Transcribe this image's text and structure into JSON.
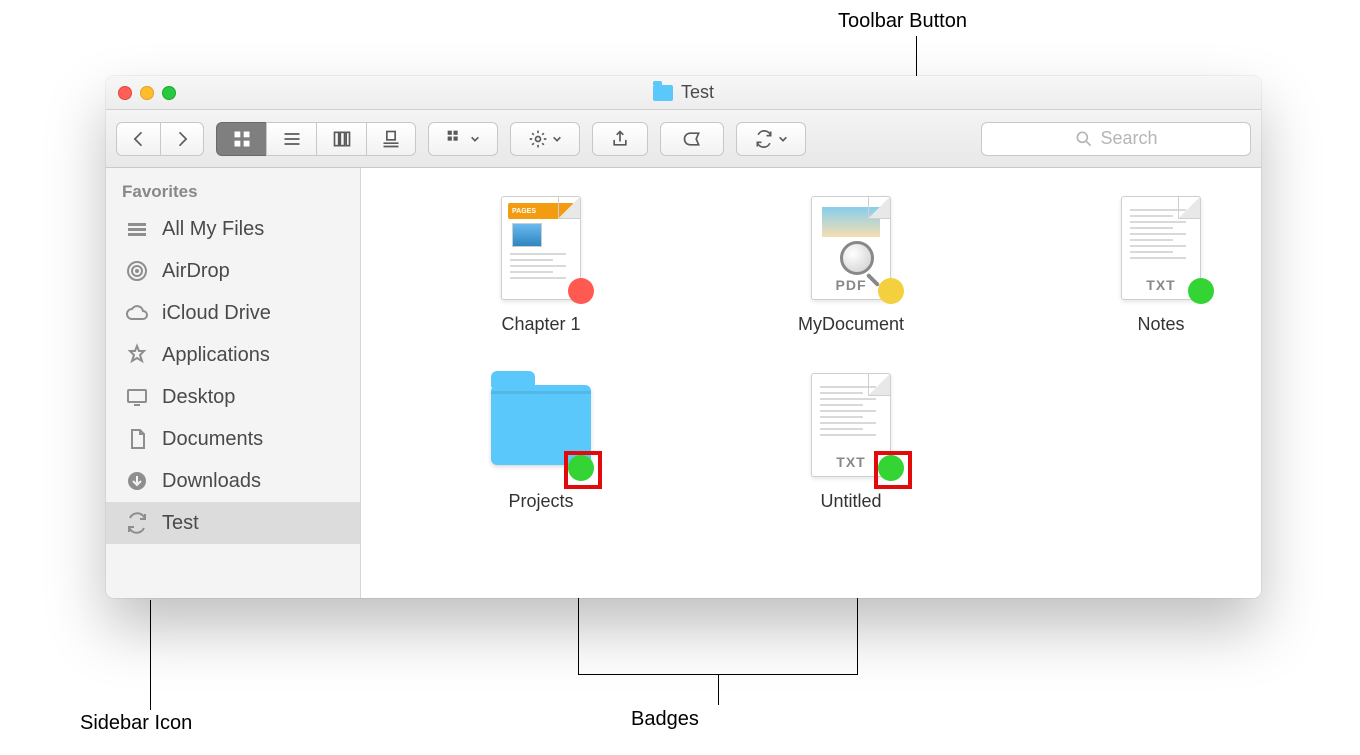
{
  "annotations": {
    "toolbar_button": "Toolbar Button",
    "sidebar_icon": "Sidebar Icon",
    "badges": "Badges"
  },
  "window": {
    "title": "Test"
  },
  "search": {
    "placeholder": "Search"
  },
  "sidebar": {
    "header": "Favorites",
    "items": [
      {
        "icon": "all-my-files-icon",
        "label": "All My Files",
        "selected": false
      },
      {
        "icon": "airdrop-icon",
        "label": "AirDrop",
        "selected": false
      },
      {
        "icon": "icloud-icon",
        "label": "iCloud Drive",
        "selected": false
      },
      {
        "icon": "applications-icon",
        "label": "Applications",
        "selected": false
      },
      {
        "icon": "desktop-icon",
        "label": "Desktop",
        "selected": false
      },
      {
        "icon": "documents-icon",
        "label": "Documents",
        "selected": false
      },
      {
        "icon": "downloads-icon",
        "label": "Downloads",
        "selected": false
      },
      {
        "icon": "sync-icon",
        "label": "Test",
        "selected": true
      }
    ]
  },
  "files": {
    "row1": [
      {
        "name": "Chapter 1",
        "type": "pages",
        "ext": "",
        "badge": "red",
        "highlight": false
      },
      {
        "name": "MyDocument",
        "type": "pdf",
        "ext": "PDF",
        "badge": "yellow",
        "highlight": false
      },
      {
        "name": "Notes",
        "type": "text",
        "ext": "TXT",
        "badge": "green",
        "highlight": false
      }
    ],
    "row2": [
      {
        "name": "Projects",
        "type": "folder",
        "ext": "",
        "badge": "green",
        "highlight": true
      },
      {
        "name": "Untitled",
        "type": "text",
        "ext": "TXT",
        "badge": "green",
        "highlight": true
      }
    ]
  }
}
